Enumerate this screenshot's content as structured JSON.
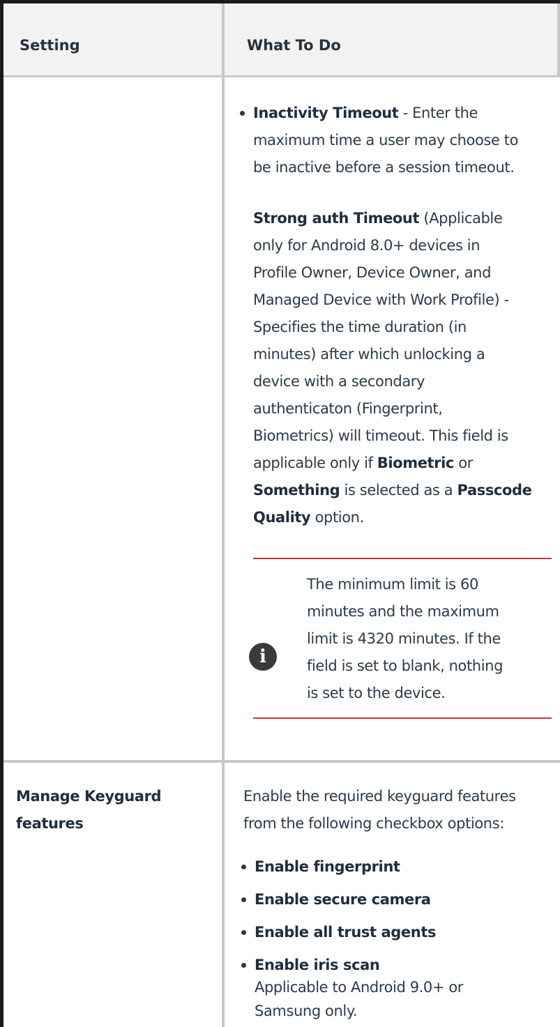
{
  "table": {
    "headers": {
      "setting": "Setting",
      "what_to_do": "What To Do"
    },
    "row1": {
      "bullet_title": "Inactivity Timeout",
      "bullet_rest_line1": " - Enter the",
      "bullet_line2": "maximum time a user may choose to",
      "bullet_line3": "be inactive before a session timeout.",
      "strong_title": "Strong auth Timeout",
      "strong_rest_line1": " (Applicable",
      "lines": [
        "only for Android 8.0+ devices in",
        "Profile Owner, Device Owner, and",
        "Managed Device with Work Profile) -",
        "Specifies the time duration (in",
        "minutes) after which unlocking a",
        "device with a secondary",
        "authenticaton (Fingerprint,",
        "Biometrics) will timeout. This field is"
      ],
      "line_applicable_pre": "applicable only if ",
      "line_applicable_bold": "Biometric",
      "line_applicable_post": " or",
      "line_something_bold": "Something",
      "line_something_mid": " is selected as a ",
      "line_something_bold2": "Passcode",
      "line_quality_bold": "Quality",
      "line_quality_post": " option.",
      "note_icon": "info-icon",
      "note_lines": [
        "The minimum limit is 60",
        "minutes and the maximum",
        "limit is 4320 minutes. If the",
        "field is set to blank, nothing",
        "is set to the device."
      ]
    },
    "row2": {
      "setting_lines": [
        "Manage Keyguard",
        "features"
      ],
      "intro_lines": [
        "Enable the required keyguard features",
        "from the following checkbox options:"
      ],
      "options": [
        "Enable fingerprint",
        "Enable secure camera",
        "Enable all trust agents",
        "Enable iris scan"
      ],
      "iris_note_lines": [
        "Applicable to Android 9.0+ or",
        "Samsung only."
      ]
    }
  },
  "colors": {
    "note_rule": "#c8323c",
    "header_bg": "#f2f2f2",
    "grid": "#c8c8c8"
  }
}
